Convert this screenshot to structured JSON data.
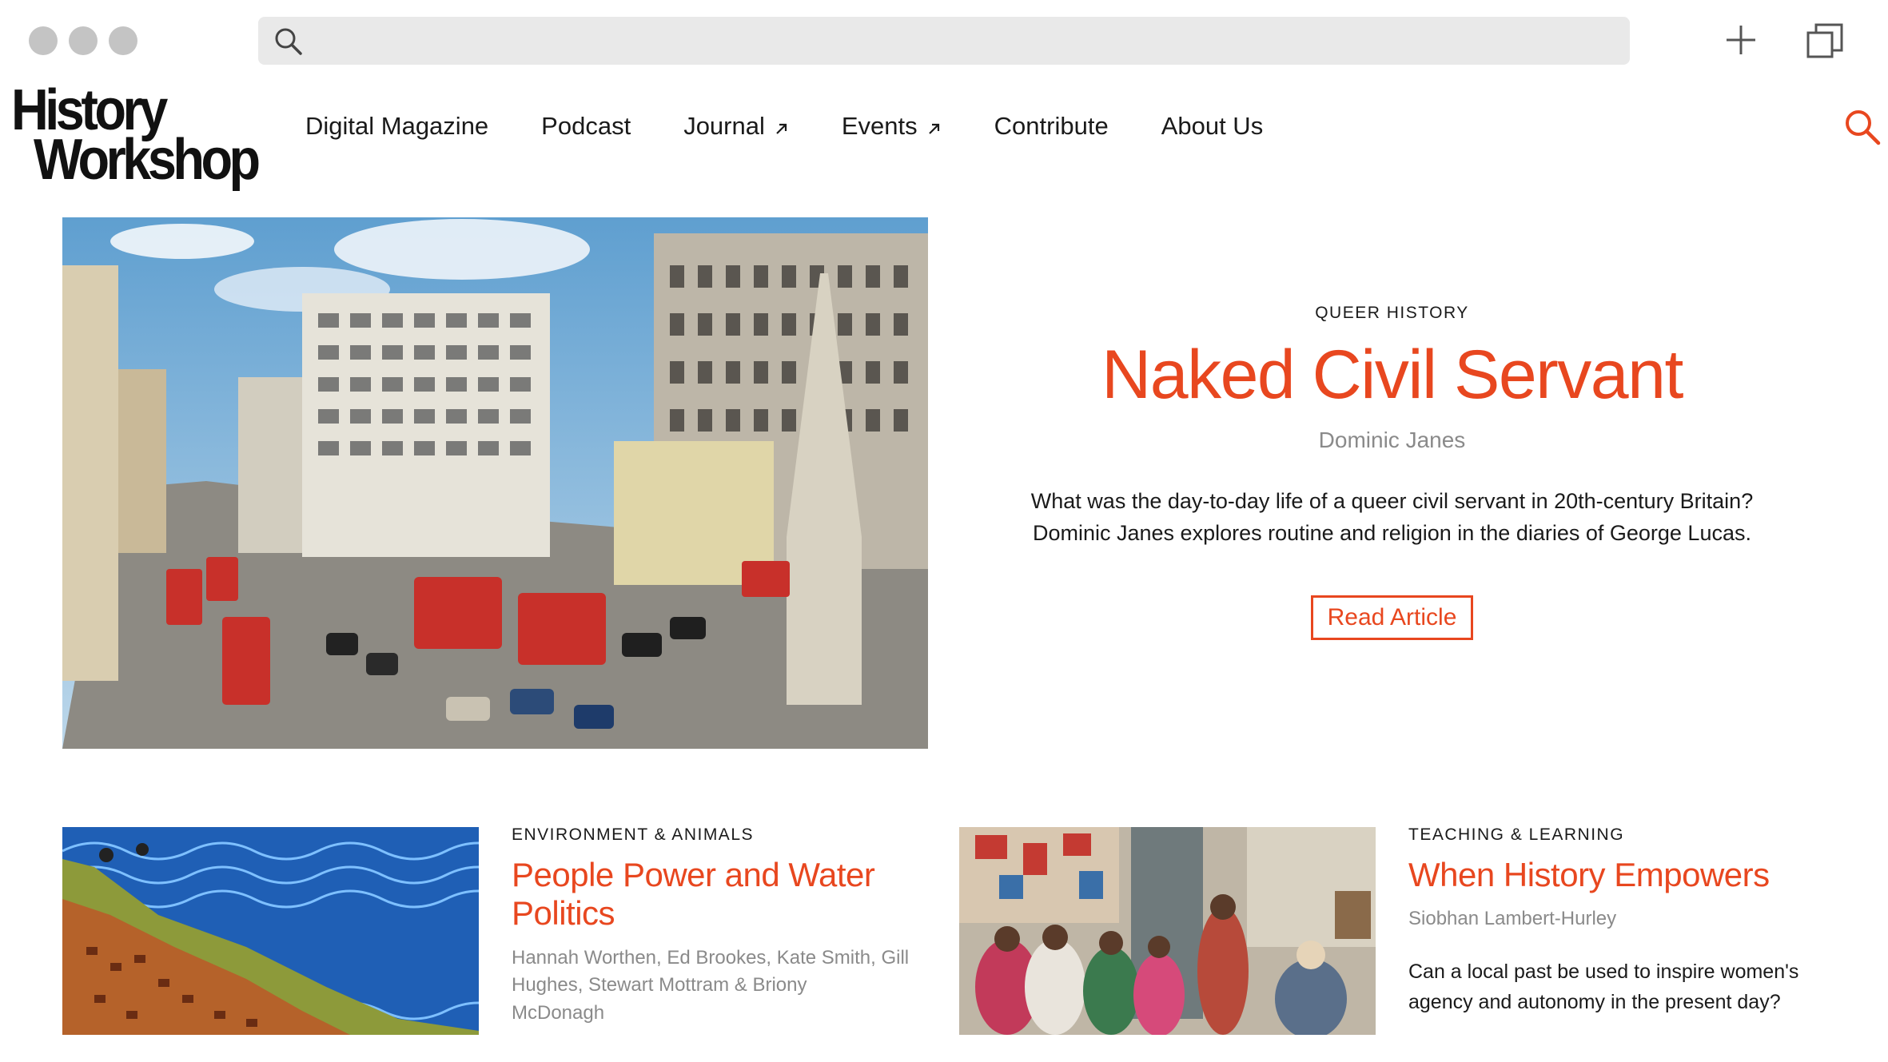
{
  "browser": {
    "search_icon": "search-icon",
    "new_tab_icon": "plus-icon",
    "tabs_icon": "tabs-icon"
  },
  "site": {
    "logo_line1": "History",
    "logo_line2": "Workshop",
    "search_icon": "search-icon",
    "accent_color": "#e8471f"
  },
  "nav": {
    "items": [
      {
        "label": "Digital Magazine",
        "external": false
      },
      {
        "label": "Podcast",
        "external": false
      },
      {
        "label": "Journal",
        "external": true
      },
      {
        "label": "Events",
        "external": true
      },
      {
        "label": "Contribute",
        "external": false
      },
      {
        "label": "About Us",
        "external": false
      }
    ]
  },
  "hero": {
    "category": "QUEER HISTORY",
    "title": "Naked Civil Servant",
    "author": "Dominic Janes",
    "description_line1": "What was the day-to-day life of a queer civil servant in 20th-century Britain?",
    "description_line2": "Dominic Janes explores routine and religion in the diaries of George Lucas.",
    "button": "Read Article"
  },
  "cards": [
    {
      "category": "ENVIRONMENT & ANIMALS",
      "title_line1": "People Power and Water",
      "title_line2": "Politics",
      "author_line1": "Hannah Worthen, Ed Brookes, Kate Smith, Gill",
      "author_line2": "Hughes, Stewart Mottram & Briony",
      "author_line3": "McDonagh"
    },
    {
      "category": "TEACHING & LEARNING",
      "title": "When History Empowers",
      "author": "Siobhan Lambert-Hurley",
      "description_line1": "Can a local past be used to inspire women's",
      "description_line2": "agency and autonomy in the present day?"
    }
  ]
}
